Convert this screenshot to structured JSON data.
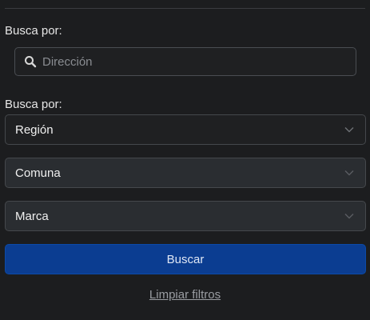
{
  "search_section": {
    "label": "Busca por:",
    "input": {
      "placeholder": "Dirección",
      "value": ""
    }
  },
  "filter_section": {
    "label": "Busca por:",
    "selects": [
      {
        "label": "Región",
        "state": "enabled"
      },
      {
        "label": "Comuna",
        "state": "disabled"
      },
      {
        "label": "Marca",
        "state": "disabled"
      }
    ]
  },
  "actions": {
    "search_label": "Buscar",
    "clear_label": "Limpiar filtros"
  },
  "colors": {
    "background": "#1c1d1f",
    "primary_button": "#0b3d91",
    "link": "#9a9da2"
  },
  "icons": {
    "search": "search-icon",
    "chevron": "chevron-down-icon"
  }
}
